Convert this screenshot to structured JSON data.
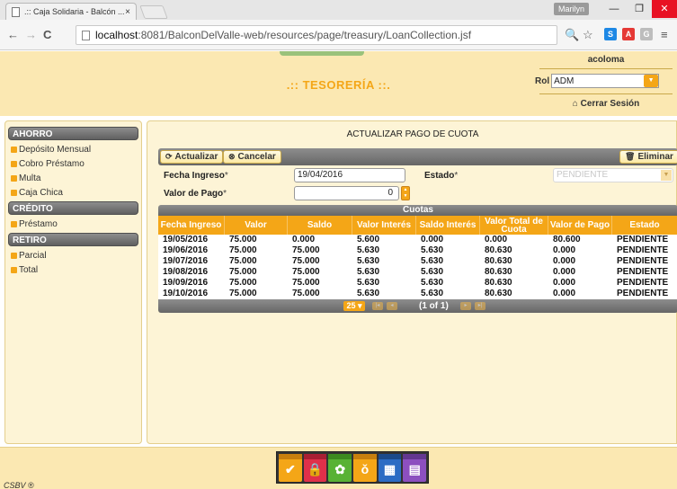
{
  "browser": {
    "tab_title": ".:: Caja Solidaria - Balcón ...",
    "tab_close": "×",
    "user_badge": "Marilyn",
    "url_host": "localhost",
    "url_rest": ":8081/BalconDelValle-web/resources/page/treasury/LoanCollection.jsf",
    "minimize": "—",
    "restore": "❐",
    "close": "✕"
  },
  "header": {
    "title": ".:: TESORERÍA ::.",
    "username": "acoloma",
    "rol_label": "Rol",
    "rol_value": "ADM",
    "logout_label": "Cerrar Sesión"
  },
  "sidebar": {
    "sections": [
      {
        "title": "AHORRO",
        "items": [
          "Depósito Mensual",
          "Cobro Préstamo",
          "Multa",
          "Caja Chica"
        ]
      },
      {
        "title": "CRÉDITO",
        "items": [
          "Préstamo"
        ]
      },
      {
        "title": "RETIRO",
        "items": [
          "Parcial",
          "Total"
        ]
      }
    ]
  },
  "main": {
    "title": "ACTUALIZAR PAGO DE CUOTA",
    "toolbar": {
      "update_label": "Actualizar",
      "cancel_label": "Cancelar",
      "delete_label": "Eliminar"
    },
    "form": {
      "fecha_label": "Fecha Ingreso",
      "fecha_value": "19/04/2016",
      "estado_label": "Estado",
      "estado_value": "PENDIENTE",
      "valor_label": "Valor de Pago",
      "valor_value": "0",
      "required_mark": "*"
    },
    "table": {
      "caption": "Cuotas",
      "columns": [
        "Fecha Ingreso",
        "Valor",
        "Saldo",
        "Valor Interés",
        "Saldo Interés",
        "Valor Total de Cuota",
        "Valor de Pago",
        "Estado"
      ],
      "rows": [
        [
          "19/05/2016",
          "75.000",
          "0.000",
          "5.600",
          "0.000",
          "0.000",
          "80.600",
          "PENDIENTE"
        ],
        [
          "19/06/2016",
          "75.000",
          "75.000",
          "5.630",
          "5.630",
          "80.630",
          "0.000",
          "PENDIENTE"
        ],
        [
          "19/07/2016",
          "75.000",
          "75.000",
          "5.630",
          "5.630",
          "80.630",
          "0.000",
          "PENDIENTE"
        ],
        [
          "19/08/2016",
          "75.000",
          "75.000",
          "5.630",
          "5.630",
          "80.630",
          "0.000",
          "PENDIENTE"
        ],
        [
          "19/09/2016",
          "75.000",
          "75.000",
          "5.630",
          "5.630",
          "80.630",
          "0.000",
          "PENDIENTE"
        ],
        [
          "19/10/2016",
          "75.000",
          "75.000",
          "5.630",
          "5.630",
          "80.630",
          "0.000",
          "PENDIENTE"
        ]
      ],
      "rows_per_page": "25",
      "page_report": "(1 of 1)"
    }
  },
  "footer": {
    "text": "CSBV ®",
    "modules": [
      {
        "icon": "check-icon",
        "color": "#f4a617"
      },
      {
        "icon": "lock-icon",
        "color": "#e0304a"
      },
      {
        "icon": "gear-icon",
        "color": "#58b234"
      },
      {
        "icon": "money-bag-icon",
        "color": "#f4a617"
      },
      {
        "icon": "calculator-icon",
        "color": "#2b6cc4"
      },
      {
        "icon": "document-icon",
        "color": "#8c4fbf"
      }
    ]
  },
  "colors": {
    "accent": "#f4a617",
    "header_bg": "#fbe8b2",
    "panel_bg": "#fdf4d6",
    "bar_gray": "#7a7a7a"
  }
}
